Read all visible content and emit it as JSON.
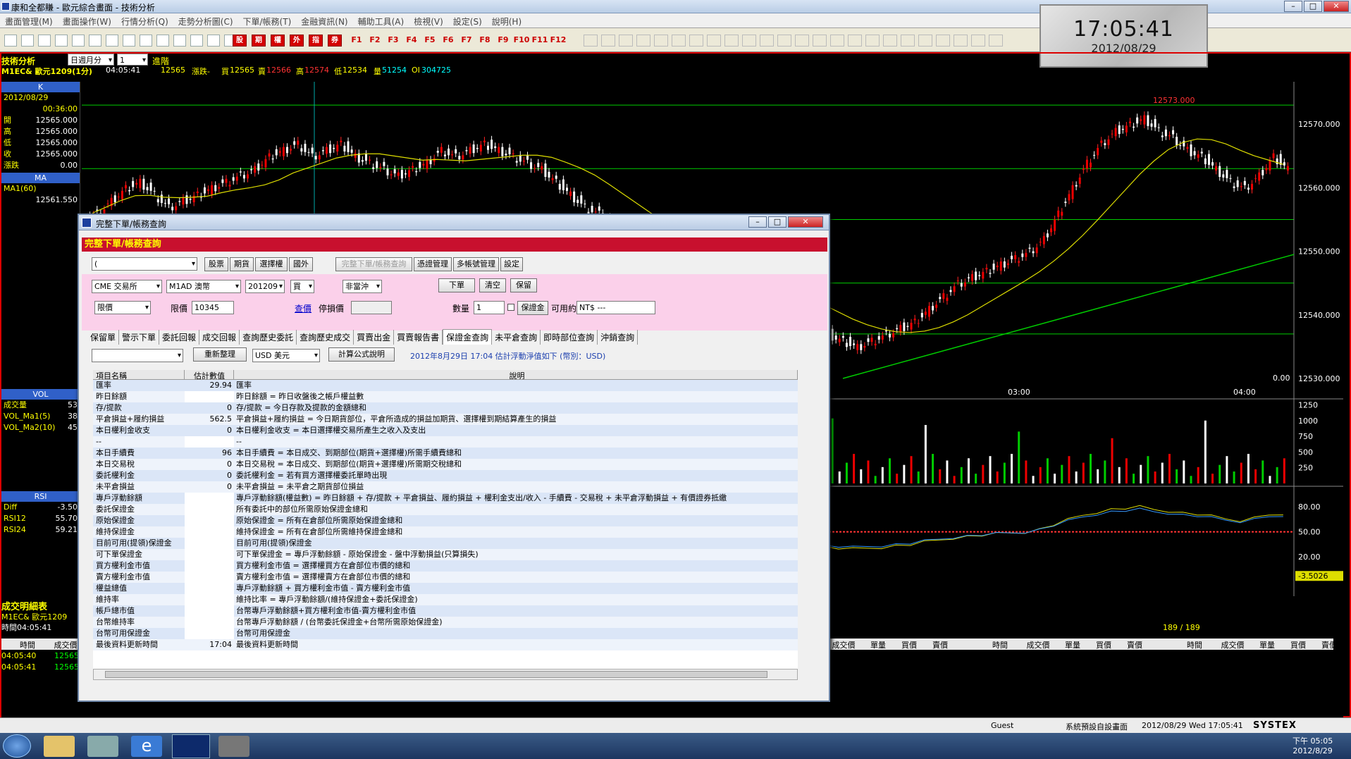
{
  "window": {
    "title": "康和全都賺 - 歐元綜合畫面 - 技術分析"
  },
  "menu": [
    "畫面管理(M)",
    "畫面操作(W)",
    "行情分析(Q)",
    "走勢分析圖(C)",
    "下單/帳務(T)",
    "金融資訊(N)",
    "輔助工具(A)",
    "檢視(V)",
    "設定(S)",
    "說明(H)"
  ],
  "toolbar": {
    "fkeys": [
      "F1",
      "F2",
      "F3",
      "F4",
      "F5",
      "F6",
      "F7",
      "F8",
      "F9",
      "F10",
      "F11",
      "F12"
    ],
    "red_buttons": [
      "股",
      "期",
      "權",
      "外",
      "指",
      "券"
    ]
  },
  "clock": {
    "time": "17:05:41",
    "date": "2012/08/29"
  },
  "chart_header": {
    "name": "技術分析",
    "period_label": "日週月分",
    "period_value": "1",
    "advanced": "進階",
    "symbol": "M1EC&  歐元1209(1分)",
    "time": "04:05:41",
    "last": "12565",
    "change_label": "漲跌-",
    "bid_label": "買",
    "bid": "12565",
    "ask_label": "賣",
    "ask": "12566",
    "high_label": "高",
    "high": "12574",
    "low_label": "低",
    "low": "12534",
    "vol_label": "量",
    "vol": "51254",
    "oi_label": "OI",
    "oi": "304725"
  },
  "left_panel": {
    "k_title": "K",
    "date": "2012/08/29",
    "time": "00:36:00",
    "rows": [
      {
        "label": "開",
        "value": "12565.000"
      },
      {
        "label": "高",
        "value": "12565.000"
      },
      {
        "label": "低",
        "value": "12565.000"
      },
      {
        "label": "收",
        "value": "12565.000"
      },
      {
        "label": "漲跌",
        "value": "0.00"
      }
    ],
    "ma_title": "MA",
    "ma_label": "MA1(60)",
    "ma_value": "12561.550",
    "vol_title": "VOL",
    "vol_rows": [
      {
        "label": "成交量",
        "value": "53"
      },
      {
        "label": "VOL_Ma1(5)",
        "value": "38"
      },
      {
        "label": "VOL_Ma2(10)",
        "value": "45"
      }
    ],
    "rsi_title": "RSI",
    "rsi_rows": [
      {
        "label": "Diff",
        "value": "-3.50"
      },
      {
        "label": "RSI12",
        "value": "55.70"
      },
      {
        "label": "RSI24",
        "value": "59.21"
      }
    ]
  },
  "chart_data": {
    "type": "candlestick",
    "price_axis": [
      "12570.000",
      "12560.000",
      "12550.000",
      "12540.000",
      "12530.000"
    ],
    "price_ylim": [
      12529,
      12576
    ],
    "time_labels": [
      "03:00",
      "04:00"
    ],
    "high_marker": "12573.000",
    "zero_label": "0.00",
    "volume_axis": [
      "1250",
      "1000",
      "750",
      "500",
      "250"
    ],
    "rsi_axis": [
      "80.00",
      "50.00",
      "20.00"
    ],
    "rsi_current": "-3.5026",
    "closes": [
      12556,
      12558,
      12560,
      12561,
      12559,
      12557,
      12558,
      12559,
      12560,
      12561,
      12562,
      12563,
      12565,
      12566,
      12567,
      12565,
      12566,
      12567,
      12565,
      12564,
      12563,
      12562,
      12563,
      12564,
      12566,
      12565,
      12566,
      12567,
      12566,
      12565,
      12564,
      12563,
      12561,
      12559,
      12557,
      12556,
      12554,
      12552,
      12551,
      12550,
      12549,
      12548,
      12547,
      12546,
      12545,
      12544,
      12543,
      12542,
      12540,
      12539,
      12538,
      12537,
      12536,
      12535,
      12536,
      12537,
      12538,
      12539,
      12541,
      12543,
      12545,
      12546,
      12547,
      12548,
      12549,
      12550,
      12552,
      12556,
      12560,
      12564,
      12567,
      12569,
      12570,
      12571,
      12569,
      12568,
      12566,
      12565,
      12563,
      12561,
      12560,
      12562,
      12565,
      12563
    ]
  },
  "bottom_panel": {
    "title": "成交明細表",
    "symbol": "M1EC&  歐元1209",
    "time_label": "時間04:05:41",
    "columns": [
      "時間",
      "成交價",
      "單量",
      "買價",
      "賣價"
    ],
    "rows": [
      {
        "time": "04:05:40",
        "price": "12565"
      },
      {
        "time": "04:05:41",
        "price": "12565"
      }
    ],
    "count": "189 / 189"
  },
  "dialog": {
    "title": "完整下單/帳務查詢",
    "header": "完整下單/帳務查詢",
    "account_select": "(",
    "top_tabs": [
      "股票",
      "期貨",
      "選擇權",
      "國外"
    ],
    "top_buttons": [
      "完整下單/帳務查詢",
      "憑證管理",
      "多帳號管理",
      "設定"
    ],
    "exchange": "CME 交易所",
    "product": "M1AD  澳幣",
    "month": "201209",
    "side": "買",
    "offset": "非當沖",
    "order_type": "限價",
    "limit_label": "限價",
    "limit_value": "10345",
    "quote_link": "查價",
    "stop_label": "停損價",
    "qty_label": "數量",
    "qty_value": "1",
    "place_order": "下單",
    "clear": "清空",
    "keep": "保留",
    "margin_btn": "保證金",
    "available_label": "可用約",
    "available_value": "NT$ ---",
    "query_tabs": [
      "保留單",
      "警示下單",
      "委託回報",
      "成交回報",
      "查詢歷史委託",
      "查詢歷史成交",
      "買賣出金",
      "買賣報告書",
      "保證金查詢",
      "未平倉查詢",
      "即時部位查詢",
      "沖銷查詢"
    ],
    "active_tab": "保證金查詢",
    "refresh": "重新整理",
    "currency": "USD 美元",
    "formula": "計算公式說明",
    "notice": "2012年8月29日 17:04 估計浮動淨值如下 (幣別：USD)",
    "grid_headers": [
      "項目名稱",
      "估計數值",
      "說明"
    ],
    "grid_rows": [
      [
        "匯率",
        "29.94",
        "匯率"
      ],
      [
        "昨日餘額",
        "",
        "昨日餘額 = 昨日收盤後之帳戶權益數"
      ],
      [
        "存/提款",
        "0",
        "存/提款 = 今日存款及提款的金額總和"
      ],
      [
        "平倉損益+履約損益",
        "562.5",
        "平倉損益+履約損益  = 今日期貨部位，平倉所造成的損益加期貨、選擇權到期結算產生的損益"
      ],
      [
        "本日權利金收支",
        "0",
        "本日權利金收支 = 本日選擇權交易所產生之收入及支出"
      ],
      [
        "--",
        "",
        "--"
      ],
      [
        "本日手續費",
        "96",
        "本日手續費 = 本日成交、到期部位(期貨+選擇權)所需手續費總和"
      ],
      [
        "本日交易稅",
        "0",
        "本日交易稅 = 本日成交、到期部位(期貨+選擇權)所需期交稅總和"
      ],
      [
        "委託權利金",
        "0",
        "委託權利金 = 若有買方選擇權委託單時出現"
      ],
      [
        "未平倉損益",
        "0",
        "未平倉損益 = 未平倉之期貨部位損益"
      ],
      [
        "專戶浮動餘額",
        "",
        "專戶浮動餘額(權益數) = 昨日餘額 + 存/提款 + 平倉損益、履約損益 + 權利金支出/收入 - 手續費 - 交易稅 + 未平倉浮動損益 + 有價證券抵繳"
      ],
      [
        "委託保證金",
        "",
        "所有委託中的部位所需原始保證金總和"
      ],
      [
        "原始保證金",
        "",
        "原始保證金 = 所有在倉部位所需原始保證金總和"
      ],
      [
        "維持保證金",
        "",
        "維持保證金 = 所有在倉部位所需維持保證金總和"
      ],
      [
        "目前可用(提領)保證金",
        "",
        "目前可用(提領)保證金"
      ],
      [
        "可下單保證金",
        "",
        "可下單保證金 = 專戶浮動餘額 - 原始保證金 - 盤中浮動損益(只算損失)"
      ],
      [
        "買方權利金市值",
        "",
        "買方權利金市值 = 選擇權買方在倉部位市價的總和"
      ],
      [
        "賣方權利金市值",
        "",
        "賣方權利金市值 = 選擇權賣方在倉部位市價的總和"
      ],
      [
        "權益總值",
        "",
        "專戶浮動餘額 + 買方權利金市值 - 賣方權利金市值"
      ],
      [
        "維持率",
        "",
        "維持比率 = 專戶浮動餘額/(維持保證金+委託保證金)"
      ],
      [
        "帳戶總市值",
        "",
        "台幣專戶浮動餘額+買方權利金市值-賣方權利金市值"
      ],
      [
        "台幣維持率",
        "",
        "台幣專戶浮動餘額 / (台幣委託保證金+台幣所需原始保證金)"
      ],
      [
        "台幣可用保證金",
        "",
        "台幣可用保證金"
      ],
      [
        "最後資料更新時間",
        "17:04",
        "最後資料更新時間"
      ]
    ]
  },
  "status": {
    "user": "Guest",
    "layout": "系統預設自設畫面",
    "datetime": "2012/08/29 Wed 17:05:41",
    "brand": "SYSTEX"
  },
  "taskbar": {
    "time": "下午 05:05",
    "date": "2012/8/29"
  }
}
